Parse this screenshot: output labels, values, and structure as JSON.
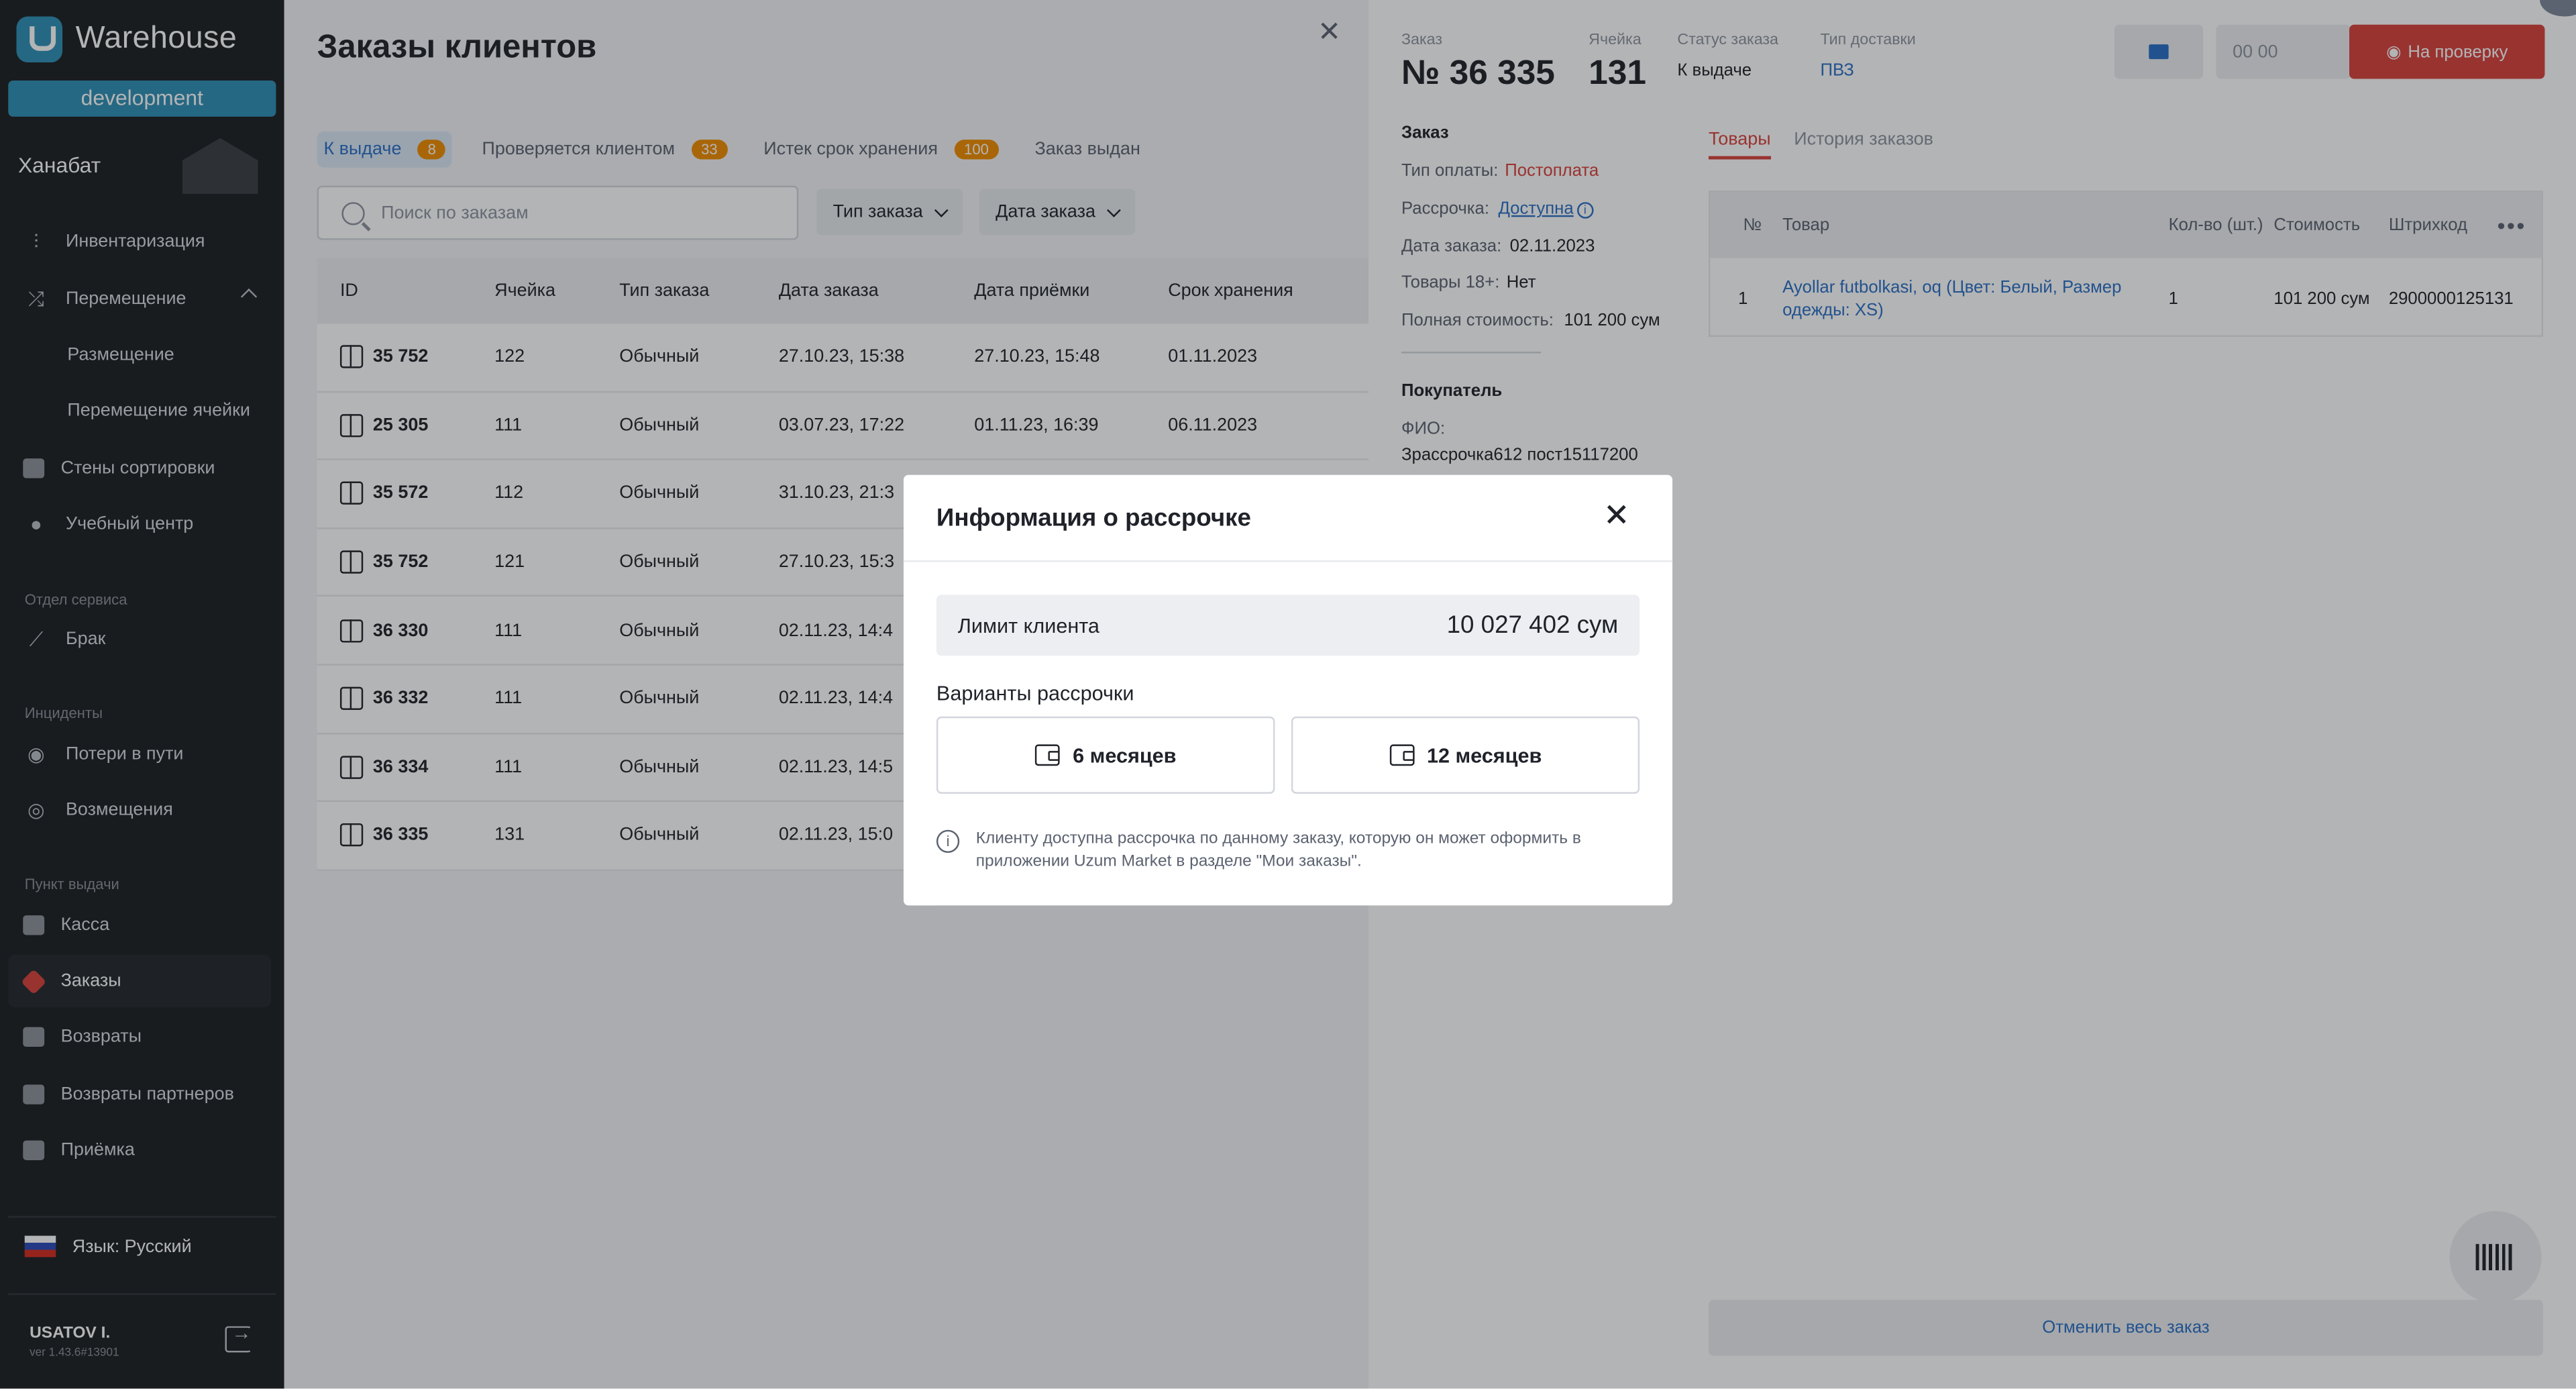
{
  "app": {
    "name": "Warehouse",
    "environment": "development",
    "warehouse": "Ханабат"
  },
  "sidebar": {
    "items": [
      {
        "label": "Инвентаризация"
      },
      {
        "label": "Перемещение"
      },
      {
        "label": "Размещение"
      },
      {
        "label": "Перемещение ячейки"
      },
      {
        "label": "Стены сортировки"
      },
      {
        "label": "Учебный центр"
      }
    ],
    "sections": [
      {
        "title": "Отдел сервиса",
        "items": [
          {
            "label": "Брак"
          }
        ]
      },
      {
        "title": "Инциденты",
        "items": [
          {
            "label": "Потери в пути"
          },
          {
            "label": "Возмещения"
          }
        ]
      },
      {
        "title": "Пункт выдачи",
        "items": [
          {
            "label": "Касса"
          },
          {
            "label": "Заказы"
          },
          {
            "label": "Возвраты"
          },
          {
            "label": "Возвраты партнеров"
          },
          {
            "label": "Приёмка"
          }
        ]
      }
    ],
    "language": "Язык: Русский",
    "user": "USATOV I.",
    "version": "ver 1.43.6#13901"
  },
  "orders": {
    "title": "Заказы клиентов",
    "tabs": [
      {
        "label": "К выдаче",
        "count": "8"
      },
      {
        "label": "Проверяется клиентом",
        "count": "33"
      },
      {
        "label": "Истек срок хранения",
        "count": "100"
      },
      {
        "label": "Заказ выдан",
        "count": ""
      }
    ],
    "search_placeholder": "Поиск по заказам",
    "filters": {
      "type": "Тип заказа",
      "date": "Дата заказа"
    },
    "columns": [
      "ID",
      "Ячейка",
      "Тип заказа",
      "Дата заказа",
      "Дата приёмки",
      "Срок хранения"
    ],
    "rows": [
      {
        "id": "35 752",
        "cell": "122",
        "type": "Обычный",
        "order_date": "27.10.23, 15:38",
        "accept_date": "27.10.23, 15:48",
        "storage": "01.11.2023"
      },
      {
        "id": "25 305",
        "cell": "111",
        "type": "Обычный",
        "order_date": "03.07.23, 17:22",
        "accept_date": "01.11.23, 16:39",
        "storage": "06.11.2023"
      },
      {
        "id": "35 572",
        "cell": "112",
        "type": "Обычный",
        "order_date": "31.10.23, 21:3",
        "accept_date": "",
        "storage": ""
      },
      {
        "id": "35 752",
        "cell": "121",
        "type": "Обычный",
        "order_date": "27.10.23, 15:3",
        "accept_date": "",
        "storage": ""
      },
      {
        "id": "36 330",
        "cell": "111",
        "type": "Обычный",
        "order_date": "02.11.23, 14:4",
        "accept_date": "",
        "storage": ""
      },
      {
        "id": "36 332",
        "cell": "111",
        "type": "Обычный",
        "order_date": "02.11.23, 14:4",
        "accept_date": "",
        "storage": ""
      },
      {
        "id": "36 334",
        "cell": "111",
        "type": "Обычный",
        "order_date": "02.11.23, 14:5",
        "accept_date": "",
        "storage": ""
      },
      {
        "id": "36 335",
        "cell": "131",
        "type": "Обычный",
        "order_date": "02.11.23, 15:0",
        "accept_date": "",
        "storage": ""
      }
    ]
  },
  "drawer": {
    "order_label": "Заказ",
    "order_number": "№ 36 335",
    "cell_label": "Ячейка",
    "cell_value": "131",
    "status_label": "Статус заказа",
    "status_value": "К выдаче",
    "delivery_label": "Тип доставки",
    "delivery_value": "ПВЗ",
    "code_placeholder": "00 00",
    "check_button": "На проверку",
    "section_order": "Заказ",
    "payment_label": "Тип оплаты:",
    "payment_value": "Постоплата",
    "installment_label": "Рассрочка:",
    "installment_value": "Доступна",
    "date_label": "Дата заказа:",
    "date_value": "02.11.2023",
    "adult_label": "Товары 18+:",
    "adult_value": "Нет",
    "total_label": "Полная стоимость:",
    "total_value": "101 200 сум",
    "section_buyer": "Покупатель",
    "fio_label": "ФИО:",
    "fio_value": "Зрассрочка612 пост15117200",
    "tabs": [
      "Товары",
      "История заказов"
    ],
    "goods_columns": [
      "№",
      "Товар",
      "Кол-во (шт.)",
      "Стоимость",
      "Штрихкод"
    ],
    "goods": [
      {
        "n": "1",
        "name": "Ayollar futbolkasi, oq (Цвет: Белый, Размер одежды: XS)",
        "qty": "1",
        "price": "101 200 сум",
        "barcode": "2900000125131"
      }
    ],
    "cancel_button": "Отменить весь заказ"
  },
  "modal": {
    "title": "Информация о рассрочке",
    "limit_label": "Лимит клиента",
    "limit_value": "10 027 402 сум",
    "variants_label": "Варианты рассрочки",
    "options": [
      "6 месяцев",
      "12 месяцев"
    ],
    "note": "Клиенту доступна рассрочка по данному заказу, которую он может оформить в приложении Uzum Market в разделе \"Мои заказы\"."
  },
  "colors": {
    "accent": "#2f8fb5",
    "danger": "#d9413c",
    "link": "#2a6fc6",
    "badge": "#f08c00"
  }
}
